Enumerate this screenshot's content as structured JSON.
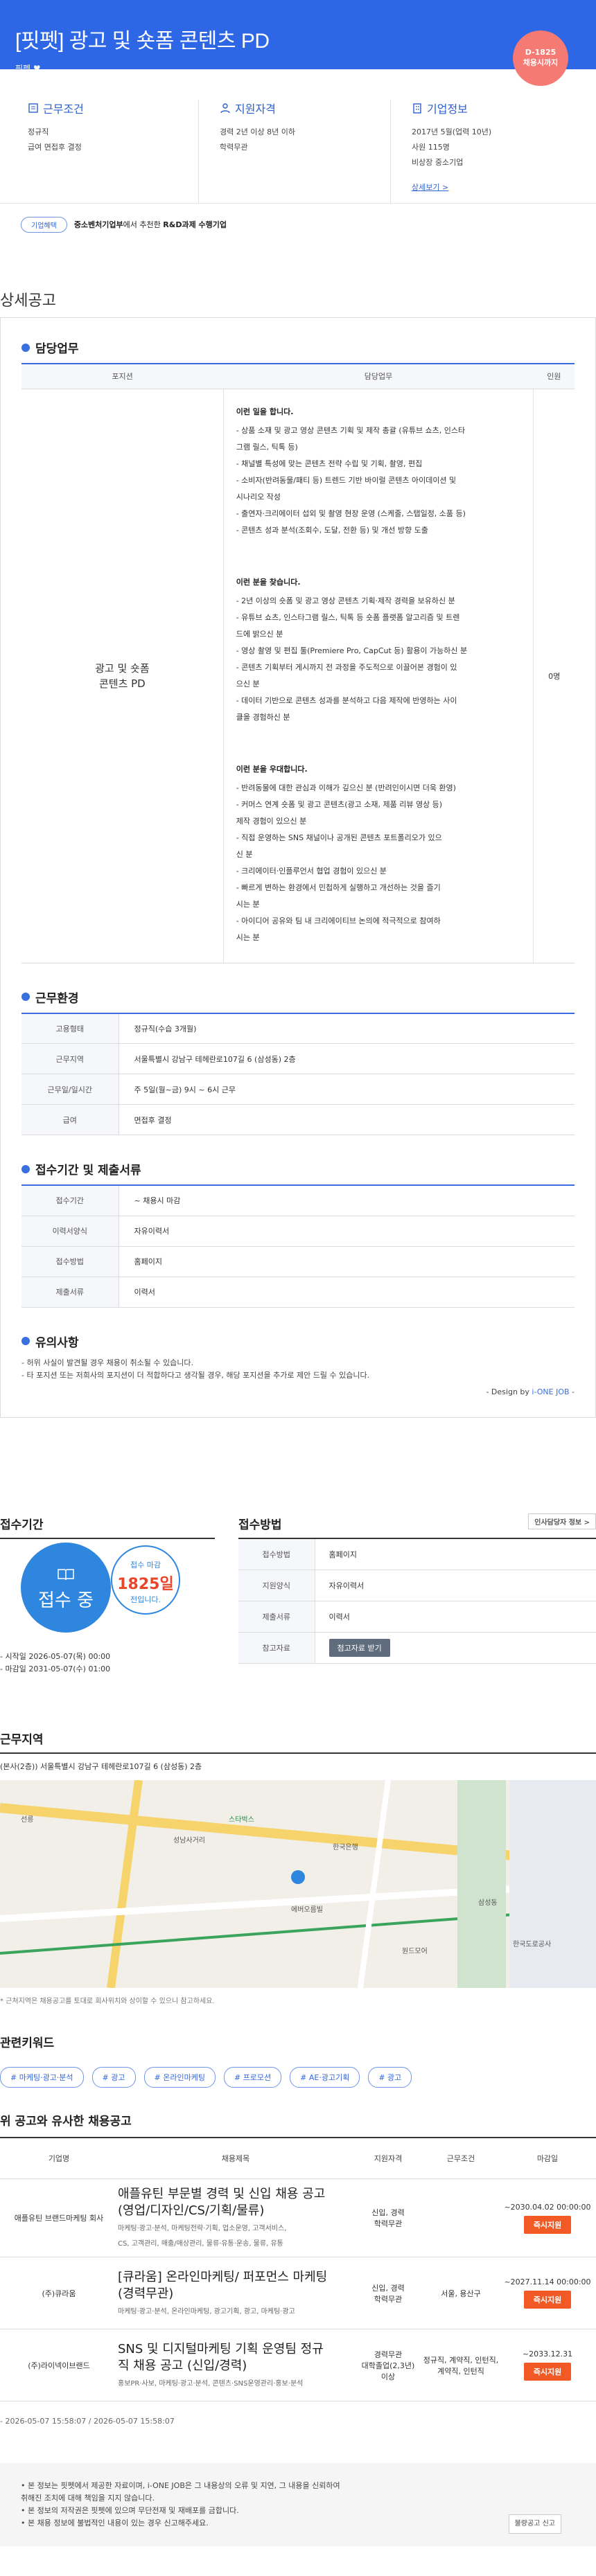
{
  "header": {
    "title": "[핏펫] 광고 및 숏폼 콘텐츠 PD",
    "company": "핏펫",
    "dday": "D-1825",
    "dday_sub": "채용시까지"
  },
  "info": {
    "conditions_title": "근무조건",
    "conditions": [
      "정규직",
      "급여 면접후 결정"
    ],
    "qual_title": "지원자격",
    "qual": [
      "경력 2년 이상 8년 이하",
      "학력무관"
    ],
    "company_title": "기업정보",
    "company_info": [
      "2017년 5월(업력 10년)",
      "사원 115명",
      "비상장 중소기업"
    ],
    "more_link": "상세보기 >"
  },
  "tagline": {
    "pill": "기업혜택",
    "text_bold": "중소벤처기업부",
    "text_mid": "에서 추천한 ",
    "text_bold2": "R&D과제 수행기업"
  },
  "detail": {
    "title": "상세공고",
    "duty_title": "담당업무",
    "duty_headers": [
      "포지션",
      "담당업무",
      "인원"
    ],
    "position": [
      "광고 및 숏폼",
      "콘텐츠 PD"
    ],
    "count": "0명",
    "blocks": [
      {
        "heading": "이런 일을 합니다.",
        "items": [
          "- 상품 소재 및 광고 영상 콘텐츠 기획 및 제작 총괄 (유튜브 쇼츠, 인스타",
          "그램 릴스, 틱톡 등)",
          "- 채널별 특성에 맞는 콘텐츠 전략 수립 및 기획, 촬영, 편집",
          "- 소비자(반려동물/패티 등) 트렌드 기반 바이럴 콘텐츠 아이데이션 및",
          "시나리오 작성",
          "- 출연자·크리에이터 섭외 및 촬영 현장 운영 (스케줄, 스탭일정, 소품 등)",
          "- 콘텐츠 성과 분석(조회수, 도달, 전환 등) 및 개선 방향 도출"
        ]
      },
      {
        "heading": "이런 분을 찾습니다.",
        "items": [
          "- 2년 이상의 숏폼 및 광고 영상 콘텐츠 기획·제작 경력을 보유하신 분",
          "- 유튜브 쇼츠, 인스타그램 릴스, 틱톡 등 숏폼 플랫폼 알고리즘 및 트렌",
          "드에 밝으신 분",
          "- 영상 촬영 및 편집 툴(Premiere Pro, CapCut 등) 활용이 가능하신 분",
          "- 콘텐츠 기획부터 게시까지 전 과정을 주도적으로 이끌어본 경험이 있",
          "으신 분",
          "- 데이터 기반으로 콘텐츠 성과를 분석하고 다음 제작에 반영하는 사이",
          "클을 경험하신 분"
        ]
      },
      {
        "heading": "이런 분을 우대합니다.",
        "items": [
          "- 반려동물에 대한 관심과 이해가 깊으신 분 (반려인이시면 더욱 환영)",
          "- 커머스 연계 숏폼 및 광고 콘텐츠(광고 소재, 제품 리뷰 영상 등)",
          "제작 경험이 있으신 분",
          "- 직접 운영하는 SNS 채널이나 공개된 콘텐츠 포트폴리오가 있으",
          "신 분",
          "- 크리에이터·인플루언서 협업 경험이 있으신 분",
          "- 빠르게 변하는 환경에서 민첩하게 실행하고 개선하는 것을 즐기",
          "시는 분",
          "- 아이디어 공유와 팀 내 크리에이티브 논의에 적극적으로 참여하",
          "시는 분"
        ]
      }
    ],
    "env_title": "근무환경",
    "env": [
      {
        "k": "고용형태",
        "v": "정규직(수습 3개월)"
      },
      {
        "k": "근무지역",
        "v": "서울특별시 강남구 테헤란로107길 6 (삼성동) 2층"
      },
      {
        "k": "근무일/일시간",
        "v": "주 5일(월~금) 9시 ~ 6시 근무"
      },
      {
        "k": "급여",
        "v": "면접후 결정"
      }
    ],
    "period_title": "접수기간 및 제출서류",
    "period": [
      {
        "k": "접수기간",
        "v": "~ 채용시 마감"
      },
      {
        "k": "이력서양식",
        "v": "자유이력서"
      },
      {
        "k": "접수방법",
        "v": "홈페이지"
      },
      {
        "k": "제출서류",
        "v": "이력서"
      }
    ],
    "notes_title": "유의사항",
    "notes": [
      "- 허위 사실이 발견될 경우 채용이 취소될 수 있습니다.",
      "- 타 포지션 또는 저희사의 포지션이 더 적합하다고 생각될 경우, 해당 포지션을 추가로 제안 드릴 수 있습니다."
    ],
    "design_prefix": "- Design by ",
    "design_brand": "i-ONE JOB",
    "design_suffix": " -"
  },
  "apply": {
    "period_title": "접수기간",
    "status": "접수 중",
    "deadline_label": "접수 마감",
    "deadline_days": "1825일",
    "deadline_sub": "전입니다.",
    "start": "- 시작일 2026-05-07(목) 00:00",
    "end": "- 마감일 2031-05-07(수) 01:00",
    "method_title": "접수방법",
    "homepage_btn": "인사담당자 정보 >",
    "rows": [
      {
        "k": "접수방법",
        "v": "홈페이지"
      },
      {
        "k": "지원양식",
        "v": "자유이력서"
      },
      {
        "k": "제출서류",
        "v": "이력서"
      }
    ],
    "attach_label": "참고자료",
    "attach_btn": "첨고자료 받기"
  },
  "area": {
    "title": "근무지역",
    "addr": "(본사(2층)) 서울특별시 강남구 테헤란로107길 6 (삼성동) 2층",
    "note": "* 근처지역은 채용공고를 토대로 회사위치와 상이할 수 있으니 참고하세요.",
    "labels": [
      "선릉",
      "성남사거리",
      "스타벅스",
      "에버오름빌",
      "한국은행",
      "삼성동",
      "원드모어",
      "한국도로공사"
    ]
  },
  "keywords": {
    "title": "관련키워드",
    "items": [
      "# 마케팅·광고·분석",
      "# 광고",
      "# 온라인마케팅",
      "# 프로모션",
      "# AE·광고기획",
      "# 광고"
    ]
  },
  "similar": {
    "title": "위 공고와 유사한 채용공고",
    "headers": [
      "기업명",
      "채용제목",
      "지원자격",
      "근무조건",
      "마감일"
    ],
    "rows": [
      {
        "company": "애플유틴 브랜드마케팅 회사",
        "title": [
          "애플유틴 부문별 경력 및 신입 채용 공고",
          "(영업/디자인/CS/기획/물류)"
        ],
        "keywords": [
          "마케팅·광고·분석, 마케팅전략·기획, 업소운영, 고객서비스,",
          "CS, 고객관리, 매출/매상관리, 물류·유통·운송, 물류, 유통"
        ],
        "qual": [
          "신입, 경력",
          "학력무관"
        ],
        "cond": "",
        "deadline": "~2030.04.02 00:00:00",
        "btn": "즉시지원"
      },
      {
        "company": "(주)큐라움",
        "title": [
          "[큐라움] 온라인마케팅/ 퍼포먼스 마케팅",
          "(경력무관)"
        ],
        "keywords": [
          "마케팅·광고·분석, 온라인마케팅, 광고기획, 광고, 마케팅·광고"
        ],
        "qual": [
          "신입, 경력",
          "학력무관"
        ],
        "cond": "서울, 용산구",
        "deadline": "~2027.11.14 00:00:00",
        "btn": "즉시지원"
      },
      {
        "company": "(주)라이넥이브랜드",
        "title": [
          "SNS 및 디지털마케팅 기획 운영팀 정규",
          "직 채용 공고 (신입/경력)"
        ],
        "keywords": [
          "홍보PR·사보, 마케팅·광고·분석, 콘텐츠·SNS운영관리·홍보·분석"
        ],
        "qual": [
          "경력무관",
          "대학졸업(2,3년)",
          "이상"
        ],
        "cond": "정규직, 계약직, 인턴직, 계약직, 인턴직",
        "deadline": "~2033.12.31",
        "btn": "즉시지원"
      }
    ]
  },
  "footer": {
    "date": "- 2026-05-07 15:58:07 / 2026-05-07 15:58:07",
    "lines": [
      "• 본 정보는 핏펫에서 제공한 자료이며, i-ONE JOB은 그 내용상의 오류 및 지연, 그 내용을 신뢰하여",
      "  취해진 조치에 대해 책임을 지지 않습니다.",
      "• 본 정보의 저작권은 핏펫에 있으며 무단전재 및 재배포를 금합니다.",
      "• 본 채용 정보에 불법적인 내용이 있는 경우 신고해주세요."
    ],
    "report_btn": "불량공고 신고"
  },
  "colors": {
    "brand": "#2e67e6",
    "dday": "#f47a73",
    "accent_orange": "#f15a24"
  }
}
